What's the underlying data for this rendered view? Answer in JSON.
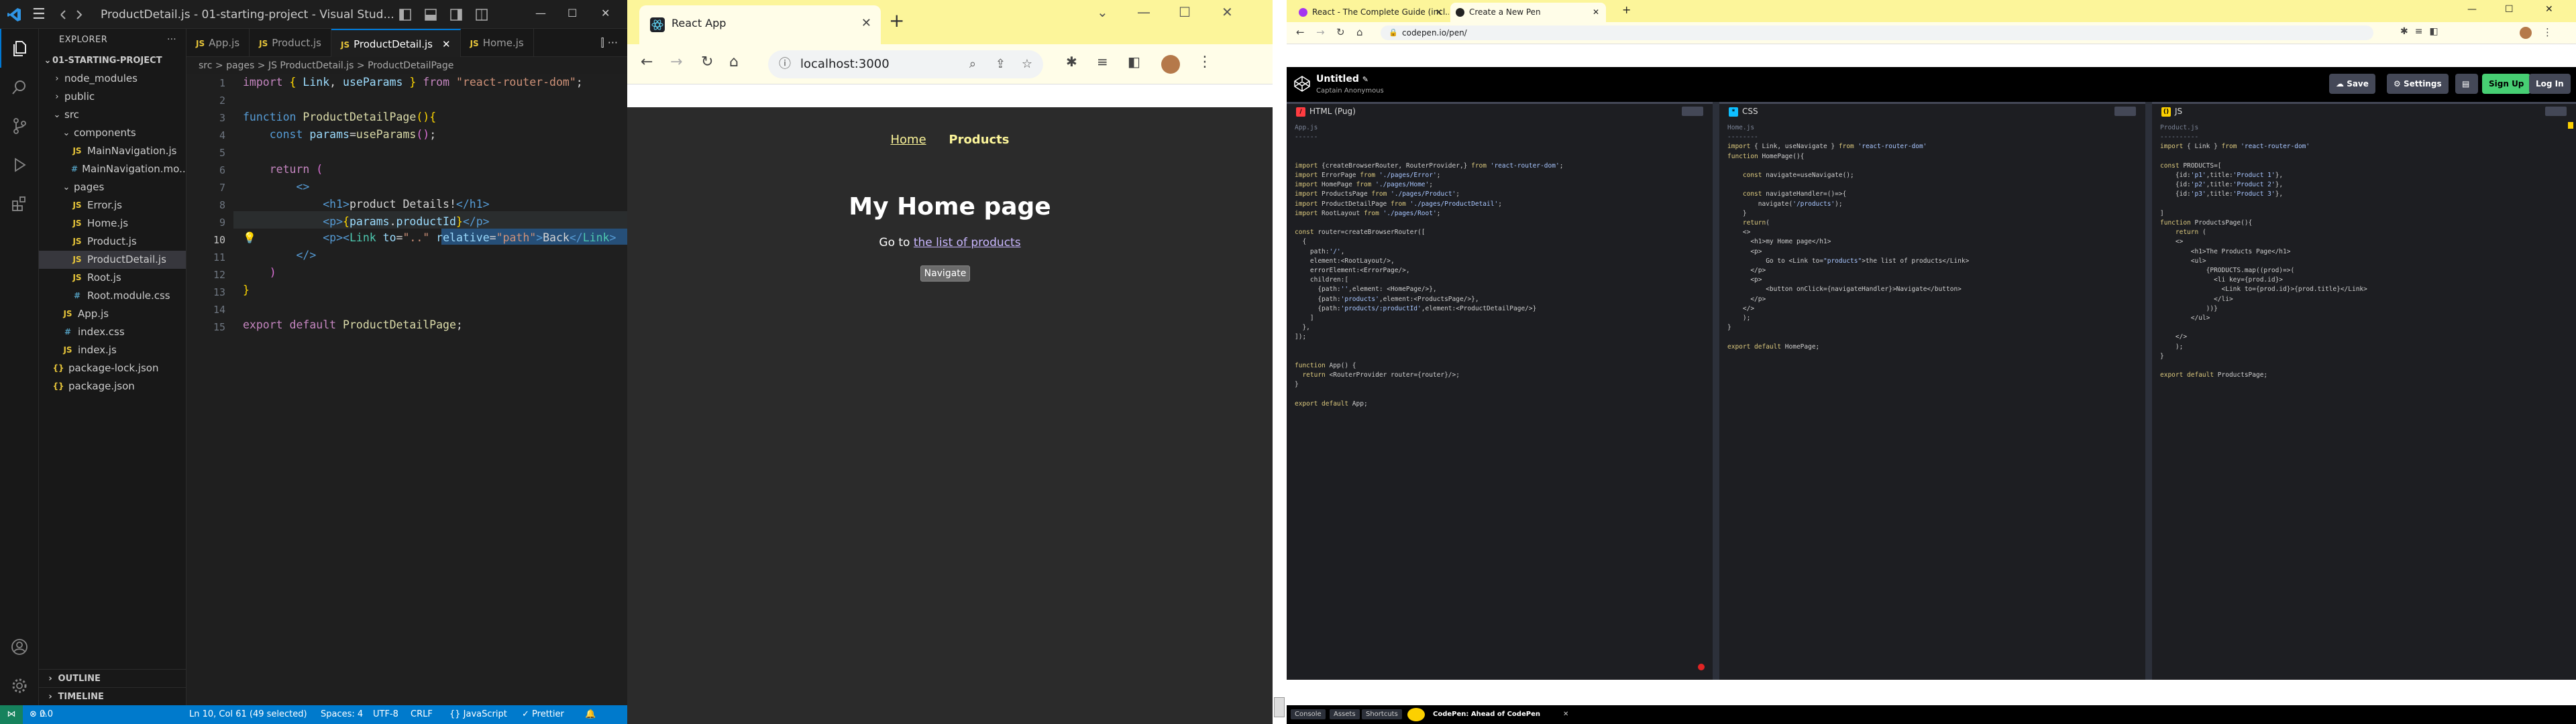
{
  "vscode": {
    "title": "ProductDetail.js - 01-starting-project - Visual Stud...",
    "explorer_label": "EXPLORER",
    "project_label": "01-STARTING-PROJECT",
    "tree": [
      {
        "label": "node_modules",
        "kind": "folder-closed",
        "depth": 1
      },
      {
        "label": "public",
        "kind": "folder-closed",
        "depth": 1
      },
      {
        "label": "src",
        "kind": "folder-open",
        "depth": 1
      },
      {
        "label": "components",
        "kind": "folder-open",
        "depth": 2
      },
      {
        "label": "MainNavigation.js",
        "kind": "js",
        "depth": 3
      },
      {
        "label": "MainNavigation.mo...",
        "kind": "css",
        "depth": 3
      },
      {
        "label": "pages",
        "kind": "folder-open",
        "depth": 2
      },
      {
        "label": "Error.js",
        "kind": "js",
        "depth": 3
      },
      {
        "label": "Home.js",
        "kind": "js",
        "depth": 3
      },
      {
        "label": "Product.js",
        "kind": "js",
        "depth": 3
      },
      {
        "label": "ProductDetail.js",
        "kind": "js",
        "depth": 3,
        "selected": true
      },
      {
        "label": "Root.js",
        "kind": "js",
        "depth": 3
      },
      {
        "label": "Root.module.css",
        "kind": "css",
        "depth": 3
      },
      {
        "label": "App.js",
        "kind": "js",
        "depth": 2
      },
      {
        "label": "index.css",
        "kind": "css",
        "depth": 2
      },
      {
        "label": "index.js",
        "kind": "js",
        "depth": 2
      },
      {
        "label": "package-lock.json",
        "kind": "json",
        "depth": 1
      },
      {
        "label": "package.json",
        "kind": "json",
        "depth": 1
      }
    ],
    "outline_label": "OUTLINE",
    "timeline_label": "TIMELINE",
    "tabs": [
      "App.js",
      "Product.js",
      "ProductDetail.js",
      "Home.js"
    ],
    "breadcrumb": "src > pages > JS ProductDetail.js > ProductDetailPage",
    "line_numbers": [
      "1",
      "2",
      "3",
      "4",
      "5",
      "6",
      "7",
      "8",
      "9",
      "10",
      "11",
      "12",
      "13",
      "14",
      "15"
    ],
    "status": {
      "errors": "0",
      "warnings": "0",
      "position": "Ln 10, Col 61 (49 selected)",
      "spaces": "Spaces: 4",
      "encoding": "UTF-8",
      "eol": "CRLF",
      "language": "{} JavaScript",
      "formatter": "✓ Prettier"
    }
  },
  "browser_react": {
    "tab_title": "React App",
    "url": "localhost:3000",
    "nav_home": "Home",
    "nav_products": "Products",
    "heading": "My Home page",
    "para_prefix": "Go to",
    "para_link": "the list of products",
    "button": "Navigate"
  },
  "browser_codepen": {
    "tabs": [
      "React - The Complete Guide (incl...",
      "Create a New Pen"
    ],
    "url": "codepen.io/pen/",
    "pen_title": "Untitled",
    "pen_author": "Captain Anonymous",
    "buttons": {
      "save": "Save",
      "settings": "Settings",
      "signup": "Sign Up",
      "login": "Log In"
    },
    "panes": [
      "HTML (Pug)",
      "CSS",
      "JS"
    ],
    "footer": {
      "console": "Console",
      "assets": "Assets",
      "shortcuts": "Shortcuts",
      "credit": "CodePen: Ahead of CodePen"
    }
  },
  "colors": {
    "vscode_blue": "#007acc",
    "codepen_green": "#47cf73",
    "react_yellow": "#fcf59a"
  }
}
